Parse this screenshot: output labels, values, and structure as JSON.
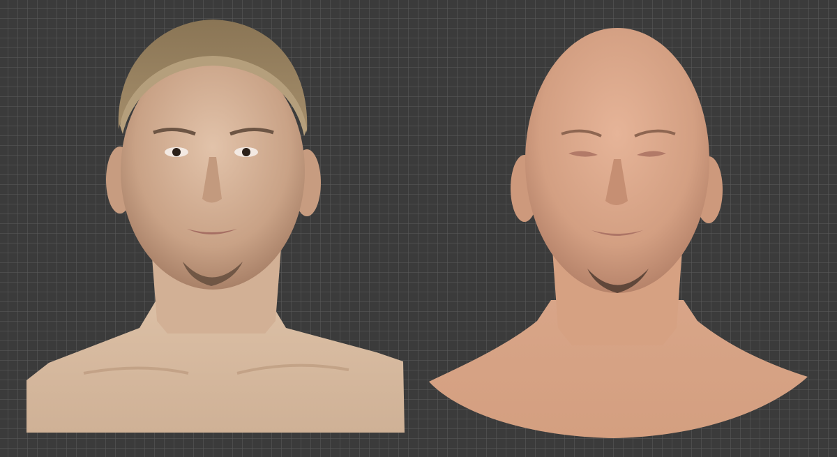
{
  "viewport": {
    "background_color": "#3b3b3b",
    "grid_color": "#5a5a5a",
    "grid": true
  },
  "models": [
    {
      "id": "scan-textured",
      "description_icon": "textured-head-scan",
      "skin_color": "#d9b79c",
      "cap_color": "#9a8565"
    },
    {
      "id": "retopo-bald",
      "description_icon": "bald-head-model",
      "skin_color": "#d9a98d"
    }
  ]
}
